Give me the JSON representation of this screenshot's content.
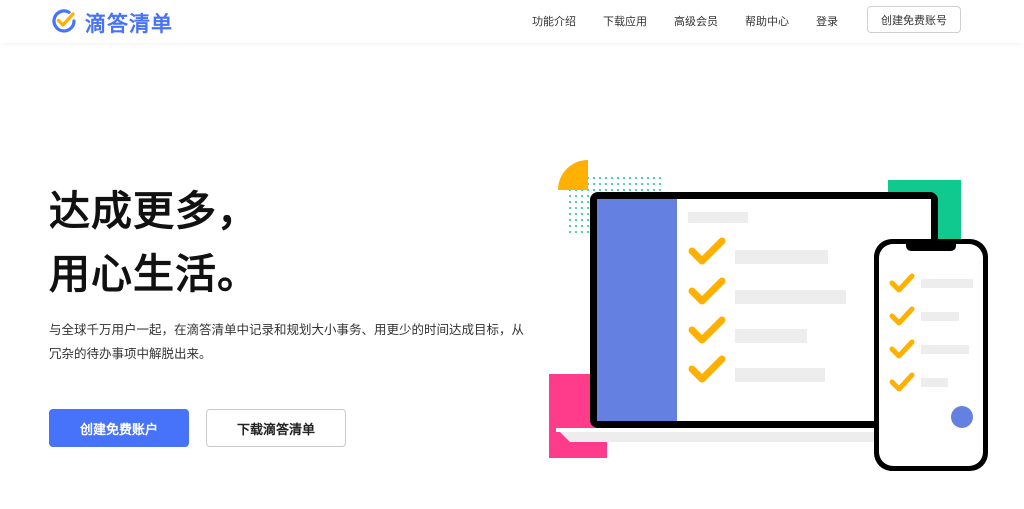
{
  "header": {
    "logo_text": "滴答清单",
    "nav": [
      {
        "label": "功能介绍"
      },
      {
        "label": "下载应用"
      },
      {
        "label": "高级会员"
      },
      {
        "label": "帮助中心"
      },
      {
        "label": "登录"
      }
    ],
    "signup_label": "创建免费账号"
  },
  "hero": {
    "title_line1": "达成更多，",
    "title_line2": "用心生活。",
    "description_line1": "与全球千万用户一起，在滴答清单中记录和规划大小事务、用更少的时间达成目标，从",
    "description_line2": "冗杂的待办事项中解脱出来。",
    "primary_button": "创建免费账户",
    "secondary_button": "下载滴答清单"
  },
  "colors": {
    "brand": "#4772fa",
    "laptop_sidebar": "#6481e1",
    "check": "#ffb000",
    "accent_green": "#10c98f",
    "accent_pink": "#ff3c8c",
    "accent_yellow": "#ffb000"
  },
  "icons": [
    "logo-check-icon",
    "checkmark-icon",
    "fab-circle-icon"
  ]
}
